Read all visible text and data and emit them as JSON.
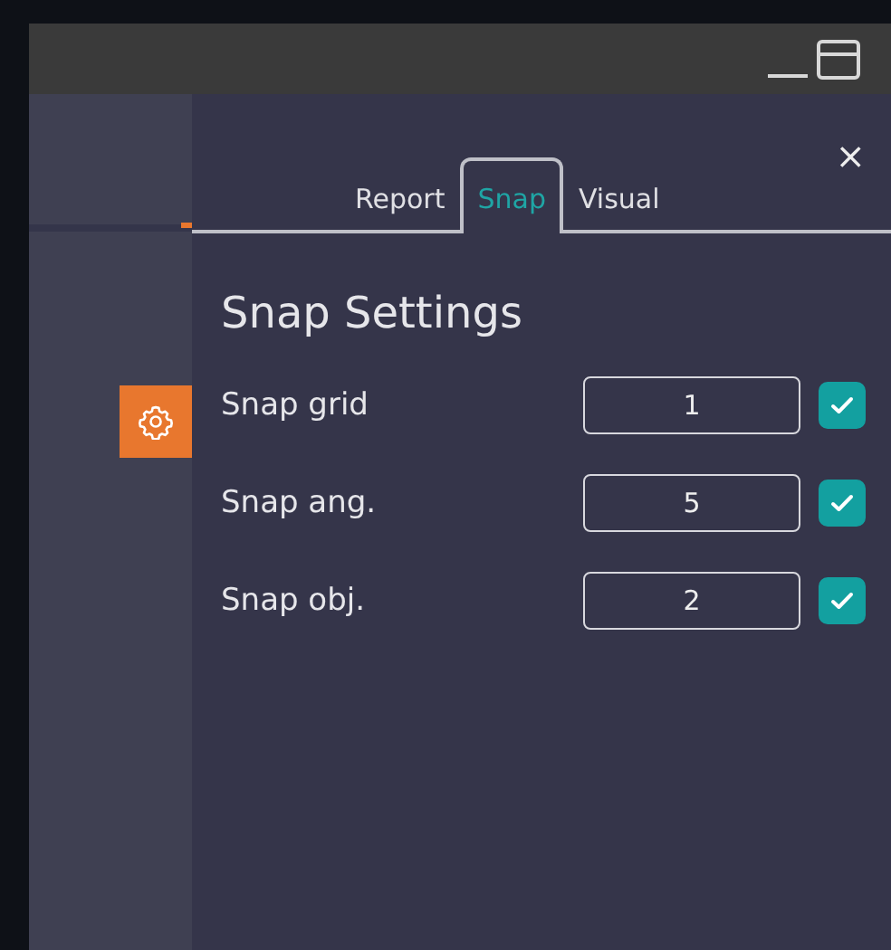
{
  "tabs": [
    {
      "label": "Report",
      "selected": false
    },
    {
      "label": "Snap",
      "selected": true
    },
    {
      "label": "Visual",
      "selected": false
    }
  ],
  "close_label": "×",
  "heading": "Snap Settings",
  "settings": [
    {
      "label": "Snap grid",
      "value": "1",
      "checked": true
    },
    {
      "label": "Snap ang.",
      "value": "5",
      "checked": true
    },
    {
      "label": "Snap obj.",
      "value": "2",
      "checked": true
    }
  ]
}
